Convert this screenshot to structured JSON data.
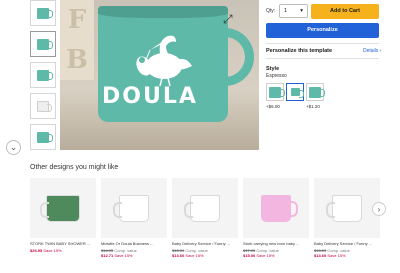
{
  "product": {
    "mug_text": "DOULA",
    "thumbnails": [
      "thumb-1",
      "thumb-2",
      "thumb-3",
      "thumb-4",
      "thumb-5"
    ]
  },
  "purchase": {
    "qty_label": "Qty:",
    "qty_value": "1",
    "add_to_cart": "Add to Cart",
    "personalize": "Personalize",
    "personalize_template": "Personalize this template",
    "details_link": "Details ›"
  },
  "style": {
    "title": "Style",
    "selected": "Espresso",
    "options": [
      {
        "price": "+$6.00"
      },
      {
        "price": ""
      },
      {
        "price": "+$1.20"
      }
    ]
  },
  "other_designs": {
    "title": "Other designs you might like",
    "cards": [
      {
        "name": "STORK TWIN BABY SHOWER ...",
        "price_now": "$26.95",
        "price_was": "",
        "comp": "Comp. value",
        "save": "Save 15%"
      },
      {
        "name": "Midwife Or Doula Business ...",
        "price_now": "$12.71",
        "price_was": "$14.95",
        "comp": "Comp. value",
        "save": "Save 15%"
      },
      {
        "name": "Baby Delivery Service / Funny ...",
        "price_now": "$13.60",
        "price_was": "$16.00",
        "comp": "Comp. value",
        "save": "Save 15%"
      },
      {
        "name": "Stork carrying new born baby ...",
        "price_now": "$15.00",
        "price_was": "$17.65",
        "comp": "Comp. value",
        "save": "Save 15%"
      },
      {
        "name": "Baby Delivery Service / Funny ...",
        "price_now": "$13.60",
        "price_was": "$16.00",
        "comp": "Comp. value",
        "save": "Save 15%"
      }
    ]
  },
  "colors": {
    "accent_blue": "#2162d8",
    "cart_yellow": "#f5b21c",
    "mug_teal": "#5fb9a8",
    "sale_red": "#c4003a"
  }
}
